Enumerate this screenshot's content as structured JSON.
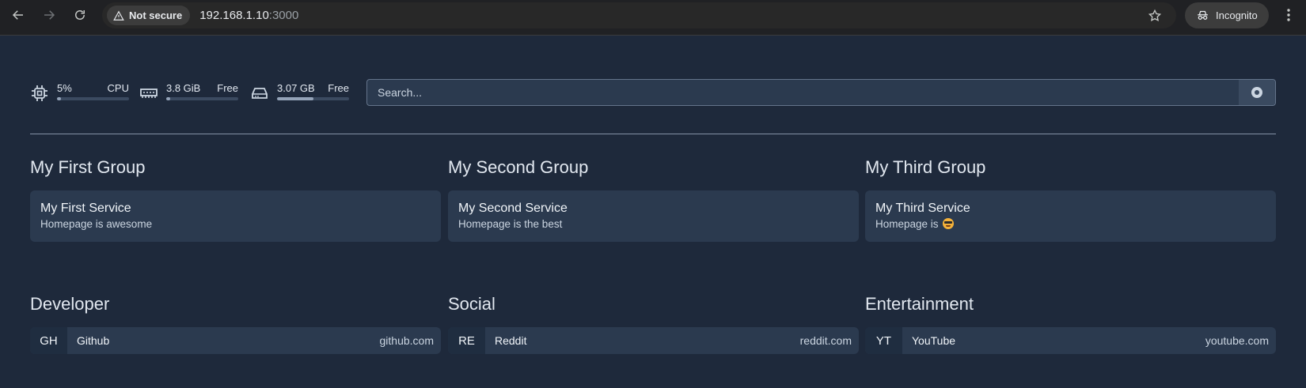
{
  "browser": {
    "secure_label": "Not secure",
    "url_host": "192.168.1.10",
    "url_port": ":3000",
    "incognito_label": "Incognito"
  },
  "resources": {
    "cpu": {
      "value": "5%",
      "label": "CPU",
      "usage": 0.05,
      "icon": "cpu-chip-icon"
    },
    "memory": {
      "value": "3.8 GiB",
      "label": "Free",
      "usage": 0.06,
      "icon": "memory-stick-icon"
    },
    "disk": {
      "value": "3.07 GB",
      "label": "Free",
      "usage": 0.5,
      "icon": "hard-drive-icon"
    }
  },
  "search": {
    "placeholder": "Search..."
  },
  "services": [
    {
      "group": "My First Group",
      "name": "My First Service",
      "description": "Homepage is awesome"
    },
    {
      "group": "My Second Group",
      "name": "My Second Service",
      "description": "Homepage is the best"
    },
    {
      "group": "My Third Group",
      "name": "My Third Service",
      "description": "Homepage is",
      "emoji": "sunglasses-emoji"
    }
  ],
  "bookmarks": [
    {
      "group": "Developer",
      "abbr": "GH",
      "name": "Github",
      "url": "github.com"
    },
    {
      "group": "Social",
      "abbr": "RE",
      "name": "Reddit",
      "url": "reddit.com"
    },
    {
      "group": "Entertainment",
      "abbr": "YT",
      "name": "YouTube",
      "url": "youtube.com"
    }
  ]
}
